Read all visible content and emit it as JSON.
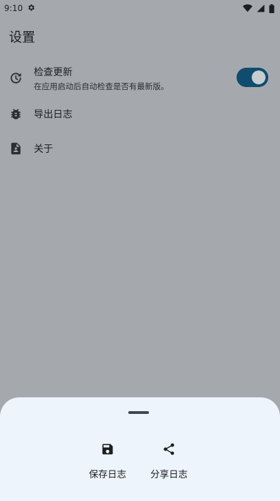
{
  "status_bar": {
    "time": "9:10",
    "icons": [
      "settings-icon",
      "wifi-icon",
      "signal-icon",
      "battery-icon"
    ]
  },
  "page": {
    "title": "设置"
  },
  "settings": {
    "check_update": {
      "icon": "update-clock-icon",
      "title": "检查更新",
      "subtitle": "在应用启动后自动检查是否有最新版。",
      "enabled": true
    },
    "export_log": {
      "icon": "bug-icon",
      "title": "导出日志"
    },
    "about": {
      "icon": "contact-document-icon",
      "title": "关于"
    }
  },
  "bottom_sheet": {
    "actions": [
      {
        "icon": "save-icon",
        "label": "保存日志"
      },
      {
        "icon": "share-icon",
        "label": "分享日志"
      }
    ]
  },
  "colors": {
    "scrim_background": "#a5a9ad",
    "switch_track": "#0f4c6e",
    "switch_thumb": "#c7ccd1",
    "sheet_background": "#edf4fb"
  }
}
